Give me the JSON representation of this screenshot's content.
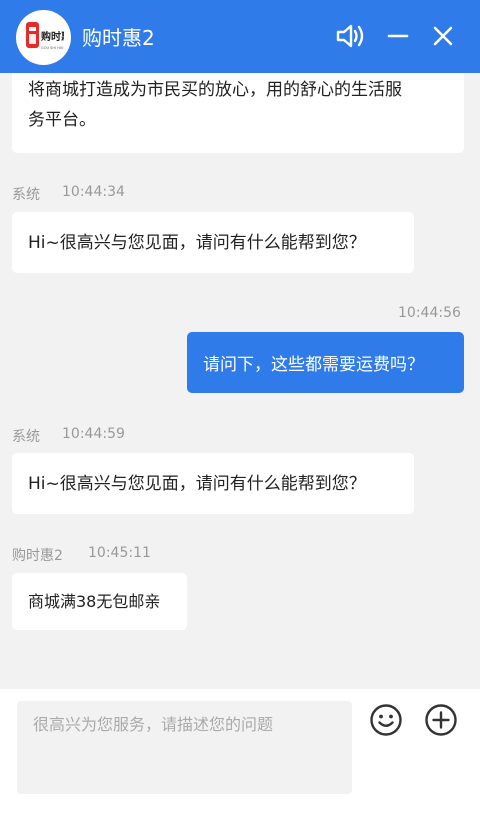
{
  "header": {
    "title": "购时惠2",
    "logo_text": "购时惠",
    "logo_subtext": "GOU SHI HUI",
    "icons": [
      "volume-icon",
      "minimize-icon",
      "close-icon"
    ]
  },
  "messages": [
    {
      "side": "left",
      "text_line1": "将商城打造成为市民买的放心，用的舒心的生活服",
      "text_line2": "务平台。"
    },
    {
      "side": "left",
      "sender": "系统",
      "time": "10:44:34",
      "text": "Hi~很高兴与您见面，请问有什么能帮到您？"
    },
    {
      "side": "right",
      "time": "10:44:56",
      "text": "请问下，这些都需要运费吗？"
    },
    {
      "side": "left",
      "sender": "系统",
      "time": "10:44:59",
      "text": "Hi~很高兴与您见面，请问有什么能帮到您？"
    },
    {
      "side": "left",
      "sender": "购时惠2",
      "time": "10:45:11",
      "text": "商城满38无包邮亲"
    }
  ],
  "footer": {
    "input_placeholder": "很高兴为您服务，请描述您的问题",
    "icons": [
      "emoji-icon",
      "add-icon"
    ]
  },
  "colors": {
    "accent": "#2f7bea",
    "background": "#f2f2f2"
  }
}
